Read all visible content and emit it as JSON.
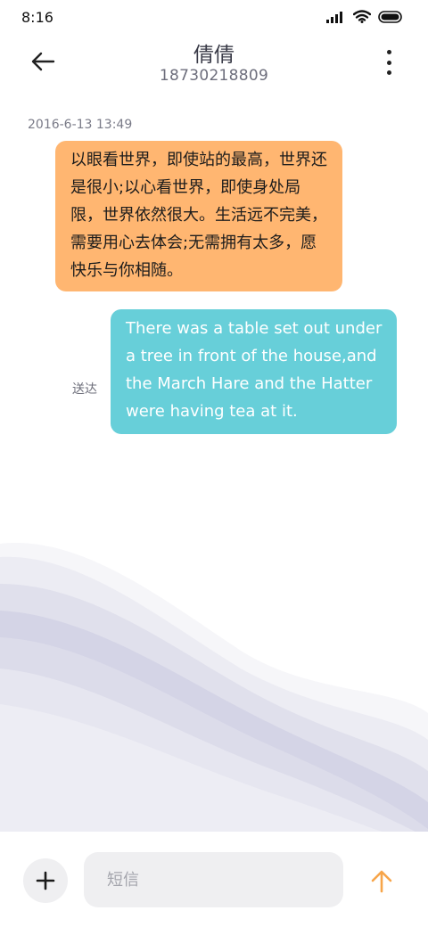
{
  "status_bar": {
    "time": "8:16",
    "icons": [
      "signal-icon",
      "wifi-icon",
      "battery-icon"
    ]
  },
  "header": {
    "contact_name": "倩倩",
    "contact_number": "18730218809",
    "back_icon": "arrow-left-icon",
    "more_icon": "more-vertical-icon"
  },
  "conversation": {
    "timestamp": "2016-6-13 13:49",
    "incoming_message": "以眼看世界，即使站的最高，世界还是很小;以心看世界，即使身处局限，世界依然很大。生活远不完美，需要用心去体会;无需拥有太多，愿快乐与你相随。",
    "outgoing_message": "There was a table set out under a tree in front of the house,and the March Hare and the Hatter were having tea at it.",
    "outgoing_status": "送达"
  },
  "composer": {
    "placeholder": "短信",
    "add_icon": "plus-icon",
    "send_icon": "arrow-up-icon"
  },
  "colors": {
    "incoming_bubble": "#ffb671",
    "outgoing_bubble": "#67cfd9",
    "send_accent": "#f7a54a",
    "input_bg": "#efeff1"
  }
}
